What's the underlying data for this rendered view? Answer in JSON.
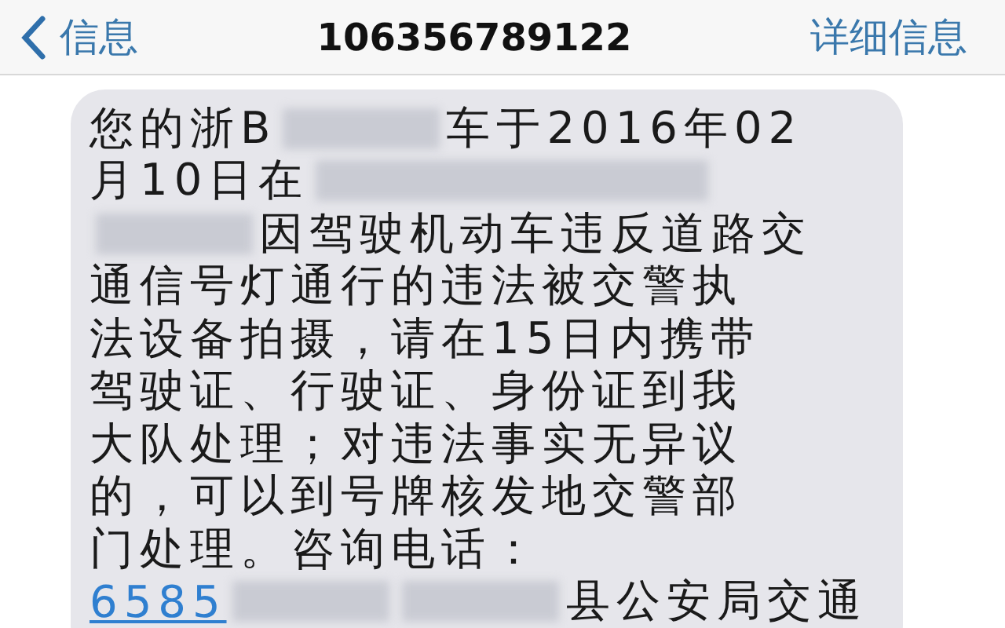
{
  "header": {
    "back_label": "信息",
    "title": "106356789122",
    "details_label": "详细信息"
  },
  "message": {
    "lines": [
      [
        {
          "kind": "text",
          "text": "您的浙B"
        },
        {
          "kind": "redacted"
        },
        {
          "kind": "text",
          "text": "车于2016年02"
        }
      ],
      [
        {
          "kind": "text",
          "text": "月10日在"
        },
        {
          "kind": "redacted_long"
        }
      ],
      [
        {
          "kind": "redacted"
        },
        {
          "kind": "text",
          "text": "因驾驶机动车违反道路交"
        }
      ],
      [
        {
          "kind": "text",
          "text": "通信号灯通行的违法被交警执"
        }
      ],
      [
        {
          "kind": "text",
          "text": "法设备拍摄，请在15日内携带"
        }
      ],
      [
        {
          "kind": "text",
          "text": "驾驶证、行驶证、身份证到我"
        }
      ],
      [
        {
          "kind": "text",
          "text": "大队处理；对违法事实无异议"
        }
      ],
      [
        {
          "kind": "text",
          "text": "的，可以到号牌核发地交警部"
        }
      ],
      [
        {
          "kind": "text",
          "text": "门处理。咨询电话："
        }
      ],
      [
        {
          "kind": "link",
          "text": "6585"
        },
        {
          "kind": "redacted"
        },
        {
          "kind": "redacted"
        },
        {
          "kind": "text",
          "text": "县公安局交通"
        }
      ]
    ]
  }
}
